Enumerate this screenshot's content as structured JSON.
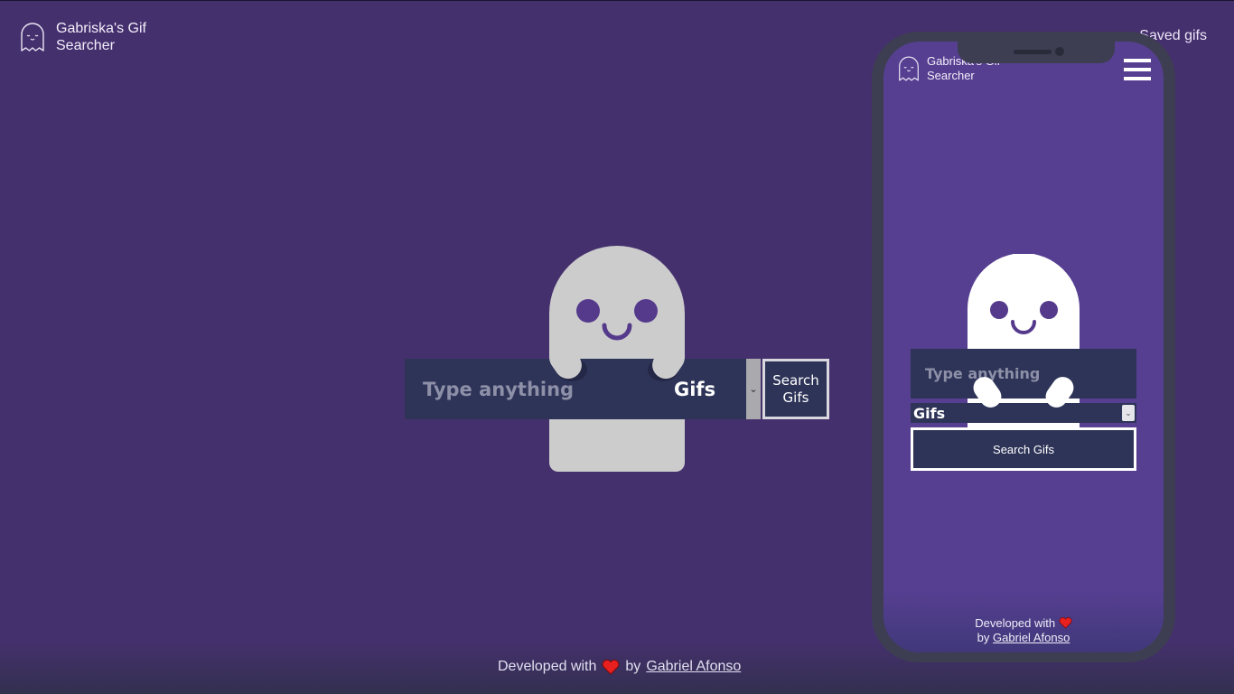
{
  "app": {
    "title": "Gabriska's Gif Searcher",
    "logo_icon": "ghost-icon"
  },
  "nav": {
    "saved_label": "Saved gifs"
  },
  "search": {
    "placeholder": "Type anything",
    "type_selected": "Gifs",
    "button_label": "Search Gifs"
  },
  "footer": {
    "developed_with": "Developed with",
    "heart_icon": "heart-icon",
    "by": "by",
    "author": "Gabriel Afonso"
  },
  "mobile_preview": {
    "title": "Gabriska's Gif Searcher",
    "menu_icon": "hamburger-icon",
    "search_placeholder": "Type anything",
    "type_selected": "Gifs",
    "button_label": "Search Gifs",
    "developed_with": "Developed with",
    "by": "by",
    "author": "Gabriel Afonso"
  },
  "colors": {
    "background": "#45306e",
    "mobile_background": "#563f91",
    "input_background": "#2e3458",
    "ghost": "#cccccc",
    "ghost_mobile": "#ffffff",
    "heart": "#e8201f"
  }
}
